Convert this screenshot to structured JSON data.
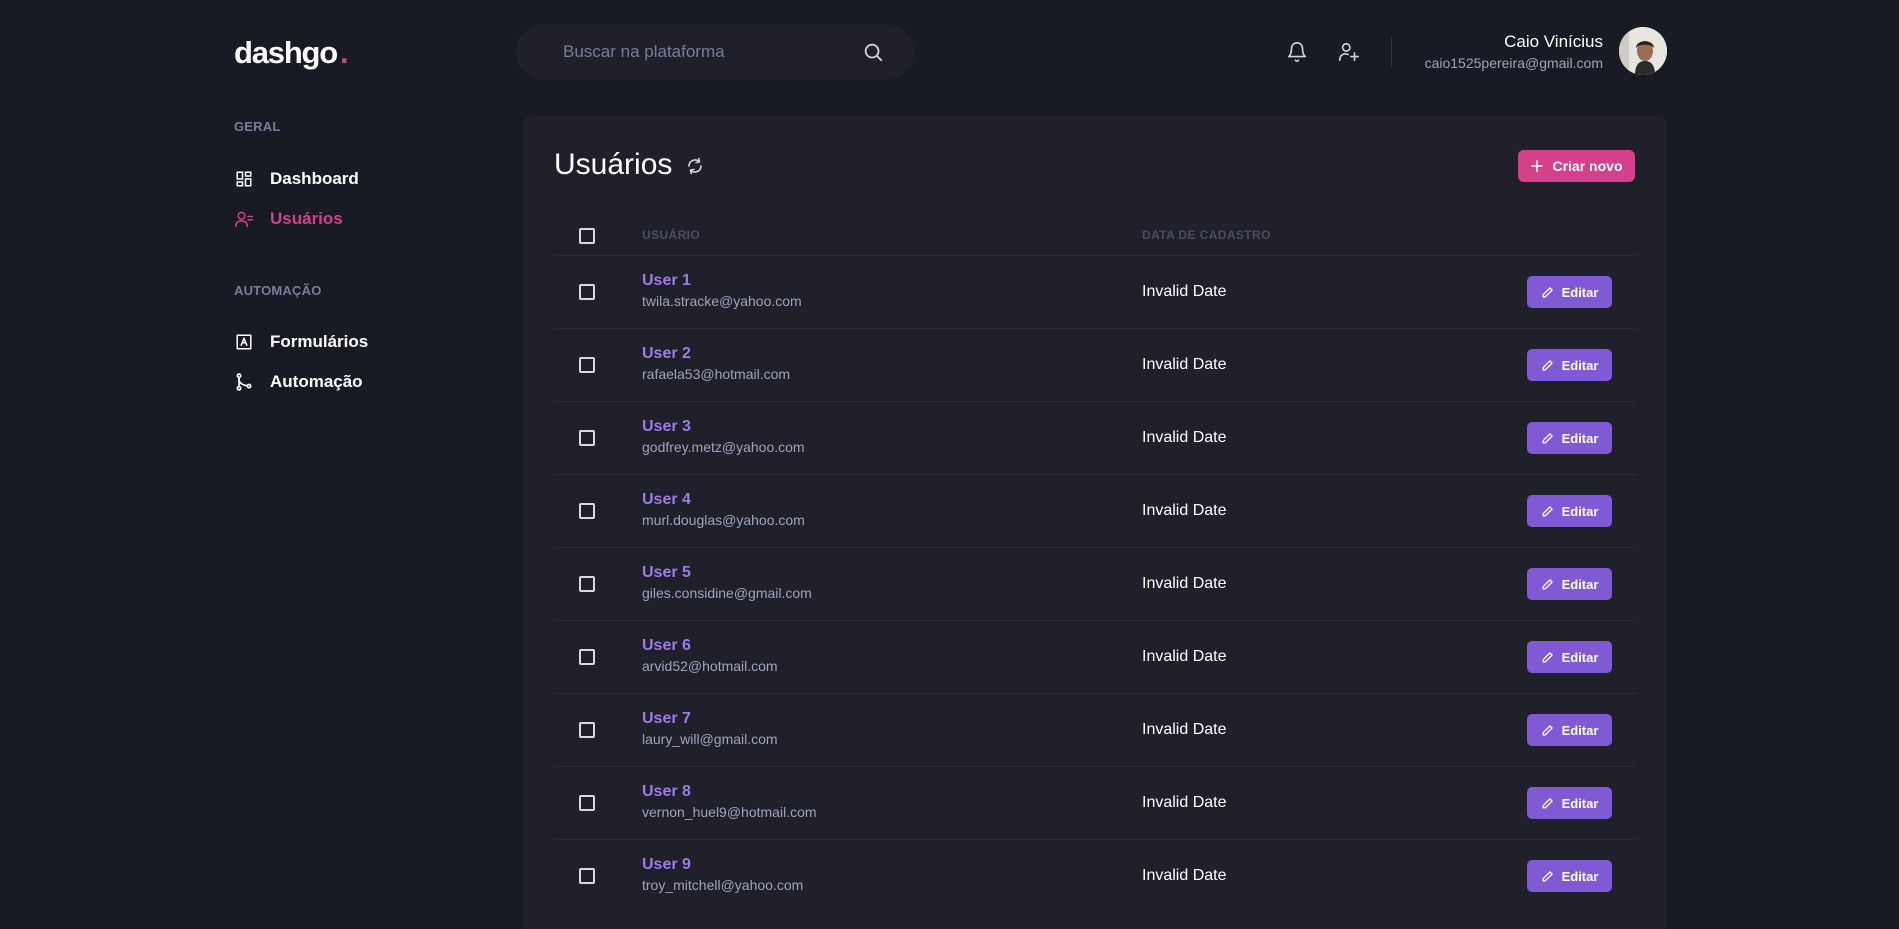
{
  "brand": {
    "name": "dashgo",
    "dot": "."
  },
  "search": {
    "placeholder": "Buscar na plataforma"
  },
  "profile": {
    "name": "Caio Vinícius",
    "email": "caio1525pereira@gmail.com"
  },
  "sidebar": {
    "sections": [
      {
        "title": "GERAL",
        "items": [
          {
            "label": "Dashboard",
            "icon": "dashboard-icon"
          },
          {
            "label": "Usuários",
            "icon": "users-icon",
            "active": true
          }
        ]
      },
      {
        "title": "AUTOMAÇÃO",
        "items": [
          {
            "label": "Formulários",
            "icon": "form-icon"
          },
          {
            "label": "Automação",
            "icon": "git-merge-icon"
          }
        ]
      }
    ]
  },
  "main": {
    "title": "Usuários",
    "create_label": "Criar novo",
    "columns": {
      "user": "USUÁRIO",
      "date": "DATA DE CADASTRO"
    },
    "edit_label": "Editar",
    "rows": [
      {
        "name": "User 1",
        "email": "twila.stracke@yahoo.com",
        "date": "Invalid Date"
      },
      {
        "name": "User 2",
        "email": "rafaela53@hotmail.com",
        "date": "Invalid Date"
      },
      {
        "name": "User 3",
        "email": "godfrey.metz@yahoo.com",
        "date": "Invalid Date"
      },
      {
        "name": "User 4",
        "email": "murl.douglas@yahoo.com",
        "date": "Invalid Date"
      },
      {
        "name": "User 5",
        "email": "giles.considine@gmail.com",
        "date": "Invalid Date"
      },
      {
        "name": "User 6",
        "email": "arvid52@hotmail.com",
        "date": "Invalid Date"
      },
      {
        "name": "User 7",
        "email": "laury_will@gmail.com",
        "date": "Invalid Date"
      },
      {
        "name": "User 8",
        "email": "vernon_huel9@hotmail.com",
        "date": "Invalid Date"
      },
      {
        "name": "User 9",
        "email": "troy_mitchell@yahoo.com",
        "date": "Invalid Date"
      }
    ]
  },
  "colors": {
    "background": "#181b23",
    "panel": "#1f2029",
    "pink": "#d53f8c",
    "purple": "#805ad5",
    "purple_text": "#9f7aea",
    "muted": "#797d9a"
  }
}
